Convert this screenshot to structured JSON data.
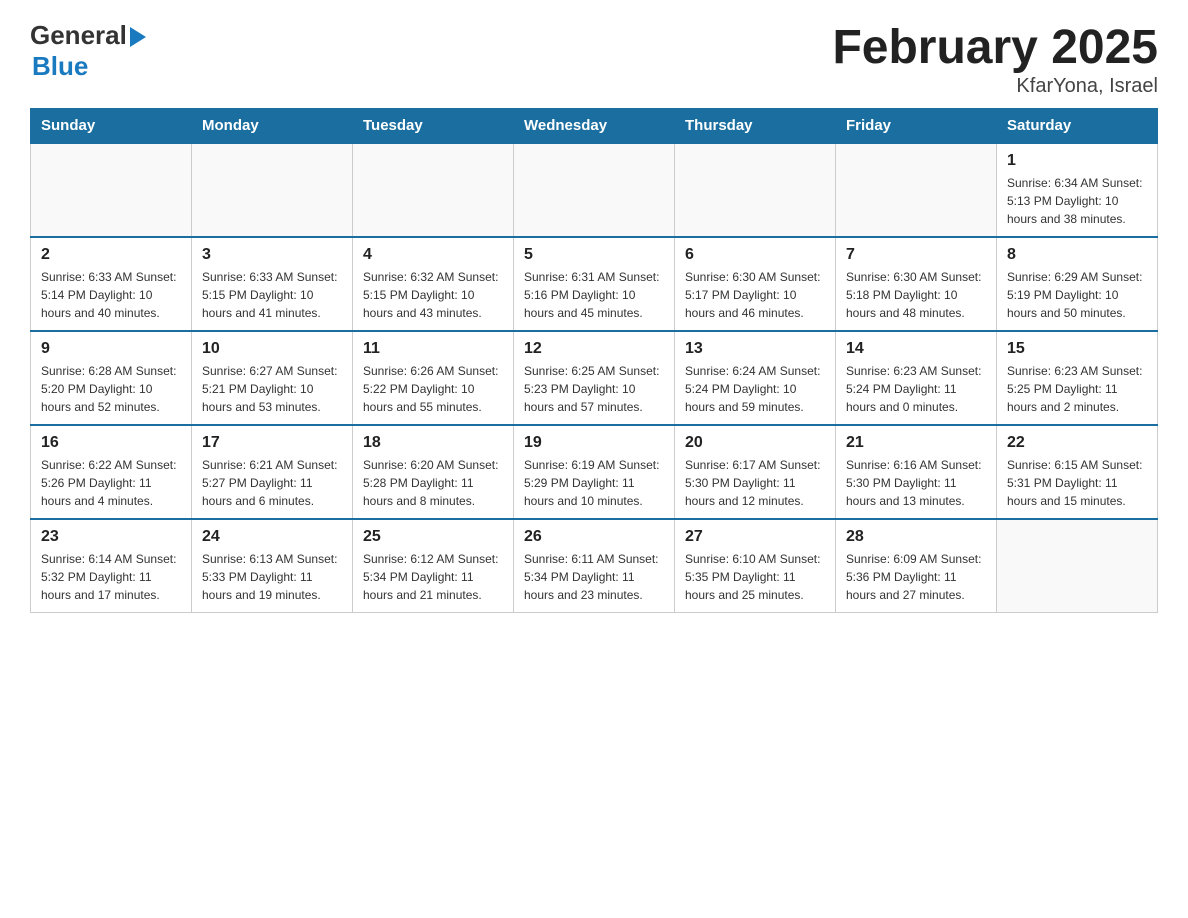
{
  "header": {
    "logo_general": "General",
    "logo_blue": "Blue",
    "title": "February 2025",
    "subtitle": "KfarYona, Israel"
  },
  "calendar": {
    "days_of_week": [
      "Sunday",
      "Monday",
      "Tuesday",
      "Wednesday",
      "Thursday",
      "Friday",
      "Saturday"
    ],
    "weeks": [
      [
        {
          "day": "",
          "info": ""
        },
        {
          "day": "",
          "info": ""
        },
        {
          "day": "",
          "info": ""
        },
        {
          "day": "",
          "info": ""
        },
        {
          "day": "",
          "info": ""
        },
        {
          "day": "",
          "info": ""
        },
        {
          "day": "1",
          "info": "Sunrise: 6:34 AM\nSunset: 5:13 PM\nDaylight: 10 hours and 38 minutes."
        }
      ],
      [
        {
          "day": "2",
          "info": "Sunrise: 6:33 AM\nSunset: 5:14 PM\nDaylight: 10 hours and 40 minutes."
        },
        {
          "day": "3",
          "info": "Sunrise: 6:33 AM\nSunset: 5:15 PM\nDaylight: 10 hours and 41 minutes."
        },
        {
          "day": "4",
          "info": "Sunrise: 6:32 AM\nSunset: 5:15 PM\nDaylight: 10 hours and 43 minutes."
        },
        {
          "day": "5",
          "info": "Sunrise: 6:31 AM\nSunset: 5:16 PM\nDaylight: 10 hours and 45 minutes."
        },
        {
          "day": "6",
          "info": "Sunrise: 6:30 AM\nSunset: 5:17 PM\nDaylight: 10 hours and 46 minutes."
        },
        {
          "day": "7",
          "info": "Sunrise: 6:30 AM\nSunset: 5:18 PM\nDaylight: 10 hours and 48 minutes."
        },
        {
          "day": "8",
          "info": "Sunrise: 6:29 AM\nSunset: 5:19 PM\nDaylight: 10 hours and 50 minutes."
        }
      ],
      [
        {
          "day": "9",
          "info": "Sunrise: 6:28 AM\nSunset: 5:20 PM\nDaylight: 10 hours and 52 minutes."
        },
        {
          "day": "10",
          "info": "Sunrise: 6:27 AM\nSunset: 5:21 PM\nDaylight: 10 hours and 53 minutes."
        },
        {
          "day": "11",
          "info": "Sunrise: 6:26 AM\nSunset: 5:22 PM\nDaylight: 10 hours and 55 minutes."
        },
        {
          "day": "12",
          "info": "Sunrise: 6:25 AM\nSunset: 5:23 PM\nDaylight: 10 hours and 57 minutes."
        },
        {
          "day": "13",
          "info": "Sunrise: 6:24 AM\nSunset: 5:24 PM\nDaylight: 10 hours and 59 minutes."
        },
        {
          "day": "14",
          "info": "Sunrise: 6:23 AM\nSunset: 5:24 PM\nDaylight: 11 hours and 0 minutes."
        },
        {
          "day": "15",
          "info": "Sunrise: 6:23 AM\nSunset: 5:25 PM\nDaylight: 11 hours and 2 minutes."
        }
      ],
      [
        {
          "day": "16",
          "info": "Sunrise: 6:22 AM\nSunset: 5:26 PM\nDaylight: 11 hours and 4 minutes."
        },
        {
          "day": "17",
          "info": "Sunrise: 6:21 AM\nSunset: 5:27 PM\nDaylight: 11 hours and 6 minutes."
        },
        {
          "day": "18",
          "info": "Sunrise: 6:20 AM\nSunset: 5:28 PM\nDaylight: 11 hours and 8 minutes."
        },
        {
          "day": "19",
          "info": "Sunrise: 6:19 AM\nSunset: 5:29 PM\nDaylight: 11 hours and 10 minutes."
        },
        {
          "day": "20",
          "info": "Sunrise: 6:17 AM\nSunset: 5:30 PM\nDaylight: 11 hours and 12 minutes."
        },
        {
          "day": "21",
          "info": "Sunrise: 6:16 AM\nSunset: 5:30 PM\nDaylight: 11 hours and 13 minutes."
        },
        {
          "day": "22",
          "info": "Sunrise: 6:15 AM\nSunset: 5:31 PM\nDaylight: 11 hours and 15 minutes."
        }
      ],
      [
        {
          "day": "23",
          "info": "Sunrise: 6:14 AM\nSunset: 5:32 PM\nDaylight: 11 hours and 17 minutes."
        },
        {
          "day": "24",
          "info": "Sunrise: 6:13 AM\nSunset: 5:33 PM\nDaylight: 11 hours and 19 minutes."
        },
        {
          "day": "25",
          "info": "Sunrise: 6:12 AM\nSunset: 5:34 PM\nDaylight: 11 hours and 21 minutes."
        },
        {
          "day": "26",
          "info": "Sunrise: 6:11 AM\nSunset: 5:34 PM\nDaylight: 11 hours and 23 minutes."
        },
        {
          "day": "27",
          "info": "Sunrise: 6:10 AM\nSunset: 5:35 PM\nDaylight: 11 hours and 25 minutes."
        },
        {
          "day": "28",
          "info": "Sunrise: 6:09 AM\nSunset: 5:36 PM\nDaylight: 11 hours and 27 minutes."
        },
        {
          "day": "",
          "info": ""
        }
      ]
    ]
  }
}
